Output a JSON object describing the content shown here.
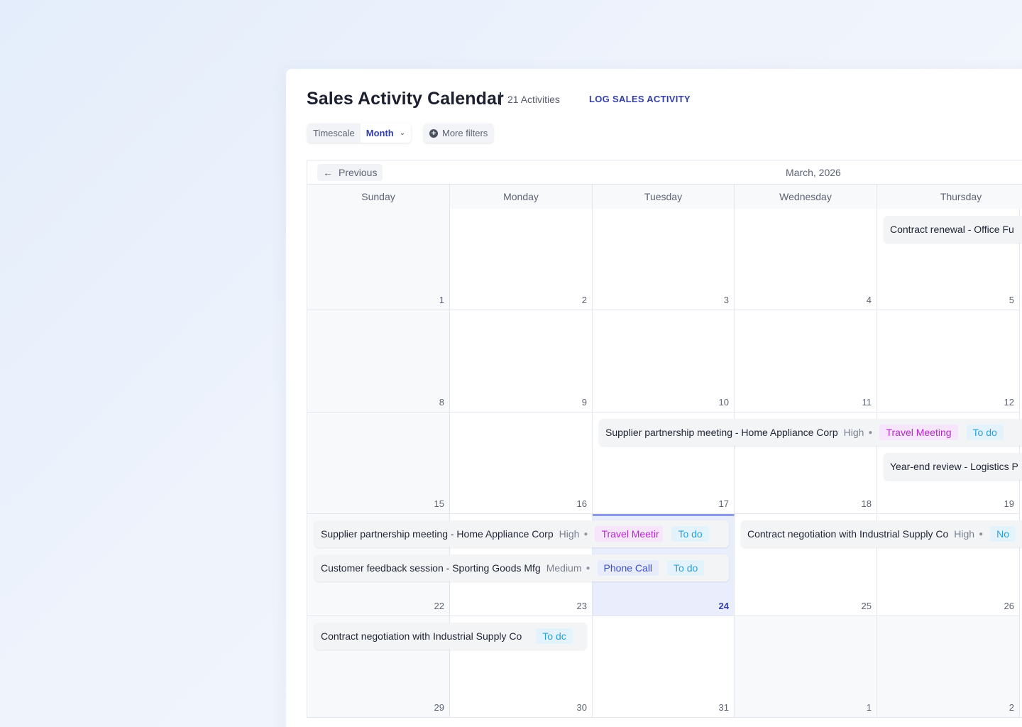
{
  "header": {
    "title": "Sales Activity Calendar",
    "count": "21 Activities",
    "log_action": "LOG SALES ACTIVITY"
  },
  "filters": {
    "timescale_label": "Timescale",
    "timescale_value": "Month",
    "more_filters": "More filters"
  },
  "calendar": {
    "previous_label": "Previous",
    "month_label": "March, 2026",
    "weekdays": [
      "Sunday",
      "Monday",
      "Tuesday",
      "Wednesday",
      "Thursday"
    ],
    "weeks": [
      [
        "1",
        "2",
        "3",
        "4",
        "5"
      ],
      [
        "8",
        "9",
        "10",
        "11",
        "12"
      ],
      [
        "15",
        "16",
        "17",
        "18",
        "19"
      ],
      [
        "22",
        "23",
        "24",
        "25",
        "26"
      ],
      [
        "29",
        "30",
        "31",
        "1",
        "2"
      ]
    ],
    "today": "24"
  },
  "events": {
    "e1": {
      "title": "Contract renewal - Office Fu"
    },
    "e2": {
      "title": "Supplier partnership meeting - Home Appliance Corp",
      "priority": "High",
      "type": "Travel Meeting",
      "status": "To do"
    },
    "e3": {
      "title": "Year-end review - Logistics P"
    },
    "e4": {
      "title": "Supplier partnership meeting - Home Appliance Corp",
      "priority": "High",
      "type": "Travel Meetir",
      "status": "To do"
    },
    "e5": {
      "title": "Contract negotiation with Industrial Supply Co",
      "priority": "High",
      "status": "No"
    },
    "e6": {
      "title": "Customer feedback session - Sporting Goods Mfg",
      "priority": "Medium",
      "type": "Phone Call",
      "status": "To do"
    },
    "e7": {
      "title": "Contract negotiation with Industrial Supply Co",
      "status": "To dc"
    }
  },
  "colors": {
    "accent": "#3440a8",
    "travel_tag": "#b22ac8",
    "phone_tag": "#3b4fc6",
    "todo_tag": "#2ba0d8",
    "today_bg": "#eaedfc"
  }
}
